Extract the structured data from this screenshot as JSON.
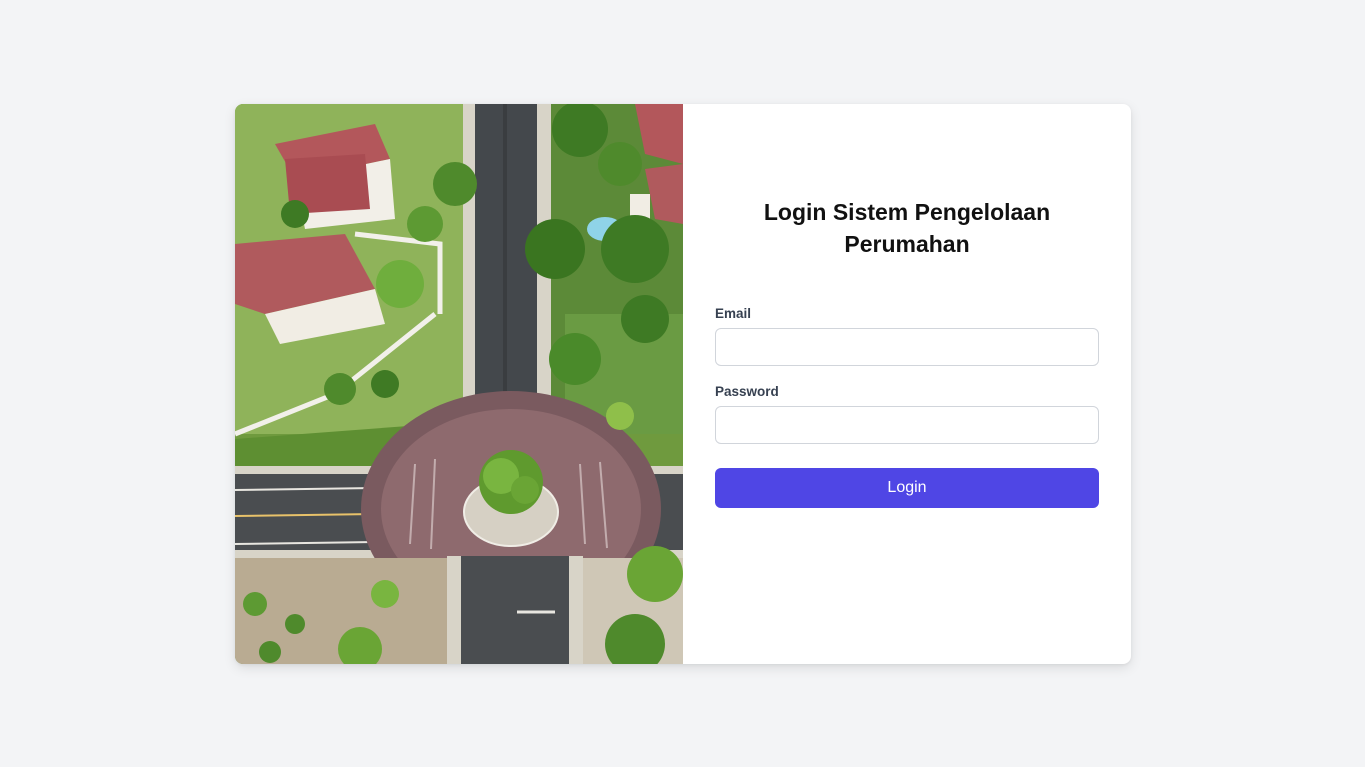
{
  "login": {
    "title": "Login Sistem Pengelolaan Perumahan",
    "email_label": "Email",
    "email_value": "",
    "password_label": "Password",
    "password_value": "",
    "submit_label": "Login"
  },
  "colors": {
    "page_background": "#f3f4f6",
    "card_background": "#ffffff",
    "button": "#4f46e5",
    "button_text": "#ffffff"
  }
}
